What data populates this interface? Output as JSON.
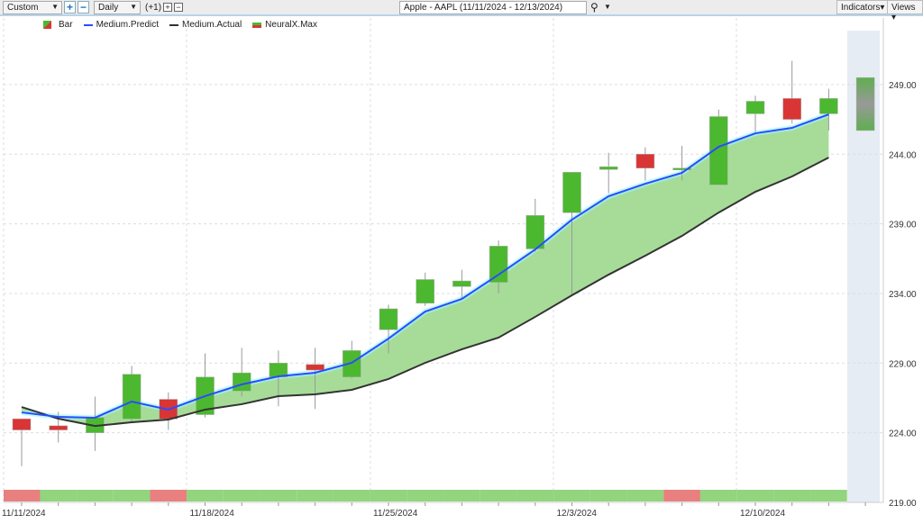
{
  "toolbar": {
    "period": "Custom",
    "interval": "Daily",
    "offset": "(+1)",
    "symbol": "Apple - AAPL (11/11/2024 - 12/13/2024)",
    "indicators": "Indicators",
    "views": "Views"
  },
  "legend": {
    "bar": "Bar",
    "predict": "Medium.Predict",
    "actual": "Medium.Actual",
    "neural": "NeuralX.Max"
  },
  "colors": {
    "up": "#4cb830",
    "down": "#d93535",
    "predict": "#2a4cff",
    "actual": "#333333",
    "fill": "#a6dc98",
    "neural_up": "#93d47f",
    "neural_down": "#e88080"
  },
  "chart_data": {
    "type": "candlestick",
    "ylim": [
      219,
      252
    ],
    "yticks": [
      "219.00",
      "224.00",
      "229.00",
      "234.00",
      "239.00",
      "244.00",
      "249.00"
    ],
    "xlabels": [
      {
        "i": 0,
        "t": "11/11/2024"
      },
      {
        "i": 5,
        "t": "11/18/2024"
      },
      {
        "i": 10,
        "t": "11/25/2024"
      },
      {
        "i": 15,
        "t": "12/3/2024"
      },
      {
        "i": 20,
        "t": "12/10/2024"
      }
    ],
    "ohlc": [
      [
        225.0,
        225.0,
        221.6,
        224.2
      ],
      [
        224.5,
        225.5,
        223.3,
        224.2
      ],
      [
        224.0,
        226.6,
        222.7,
        225.1
      ],
      [
        225.0,
        228.8,
        224.8,
        228.2
      ],
      [
        226.4,
        226.9,
        224.2,
        225.0
      ],
      [
        225.3,
        229.7,
        225.1,
        228.0
      ],
      [
        227.0,
        230.1,
        226.6,
        228.3
      ],
      [
        228.0,
        229.9,
        225.9,
        229.0
      ],
      [
        228.9,
        230.1,
        225.7,
        228.5
      ],
      [
        228.0,
        230.6,
        227.9,
        229.9
      ],
      [
        231.4,
        233.2,
        229.7,
        232.9
      ],
      [
        233.3,
        235.5,
        233.1,
        235.0
      ],
      [
        234.5,
        235.7,
        233.7,
        234.9
      ],
      [
        234.8,
        237.8,
        234.0,
        237.4
      ],
      [
        237.2,
        240.8,
        237.0,
        239.6
      ],
      [
        239.8,
        242.7,
        233.9,
        242.7
      ],
      [
        242.9,
        244.1,
        241.2,
        243.1
      ],
      [
        244.0,
        244.5,
        242.1,
        243.0
      ],
      [
        242.9,
        244.6,
        242.1,
        243.0
      ],
      [
        241.8,
        247.2,
        241.8,
        246.7
      ],
      [
        246.9,
        248.2,
        245.6,
        247.8
      ],
      [
        248.0,
        250.7,
        246.2,
        246.5
      ],
      [
        246.9,
        248.7,
        245.7,
        248.0
      ]
    ],
    "predict": [
      225.46,
      225.14,
      225.08,
      226.24,
      225.66,
      226.63,
      227.47,
      228.05,
      228.31,
      229.02,
      230.76,
      232.7,
      233.61,
      235.35,
      237.16,
      239.3,
      240.98,
      241.88,
      242.66,
      244.53,
      245.5,
      245.89,
      246.86
    ],
    "actual": [
      225.85,
      225.01,
      224.49,
      224.75,
      224.95,
      225.66,
      226.05,
      226.63,
      226.76,
      227.08,
      227.86,
      229.02,
      229.99,
      230.83,
      232.32,
      233.87,
      235.35,
      236.71,
      238.13,
      239.81,
      241.3,
      242.4,
      243.76
    ],
    "forecast_range": [
      245.7,
      249.5
    ],
    "neural": [
      "down",
      "up",
      "up",
      "up",
      "down",
      "up",
      "up",
      "up",
      "up",
      "up",
      "up",
      "up",
      "up",
      "up",
      "up",
      "up",
      "up",
      "up",
      "down",
      "up",
      "up",
      "up",
      "up"
    ]
  }
}
